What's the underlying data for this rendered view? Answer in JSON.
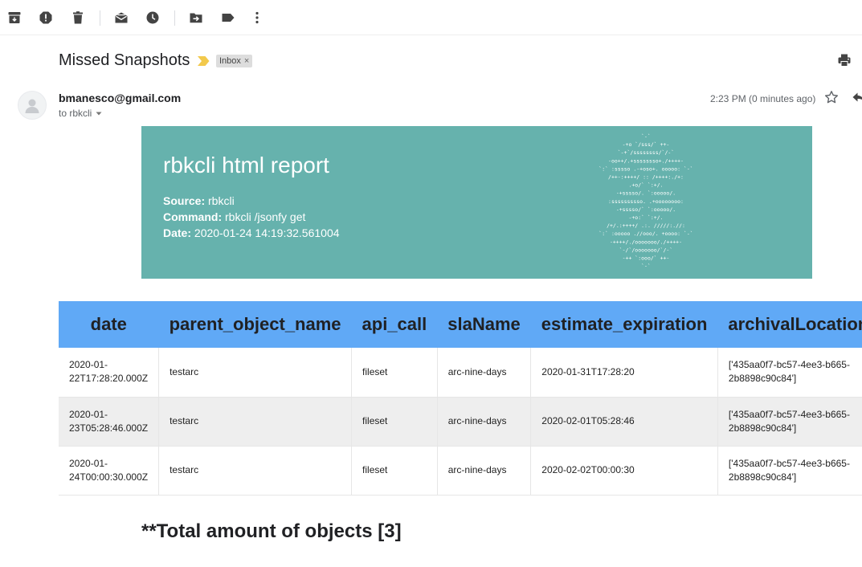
{
  "toolbar": {
    "icons": [
      "archive-icon",
      "report-spam-icon",
      "delete-icon",
      "mark-unread-icon",
      "snooze-icon",
      "move-to-icon",
      "label-icon",
      "more-icon"
    ]
  },
  "email": {
    "subject": "Missed Snapshots",
    "label": "Inbox",
    "label_close": "×",
    "sender": "bmanesco@gmail.com",
    "recipient": "to rbkcli",
    "time": "2:23 PM (0 minutes ago)"
  },
  "banner": {
    "title": "rbkcli html report",
    "source_label": "Source:",
    "source_value": "rbkcli",
    "command_label": "Command:",
    "command_value": "rbkcli /jsonfy get",
    "date_label": "Date:",
    "date_value": "2020-01-24 14:19:32.561004",
    "background": "#66b2ad",
    "ascii_art": [
      "`-`",
      "-+o    `/sss/`    ++-",
      "`-+`/ssssssss/`/-`",
      "-oo++/.+ssssssso+./++++-",
      "`:` :sssso  .-+oso+.   ooooo: `-`",
      "/++-:++++/       ::        /++++:./+:",
      ".+o/`                         `:+/.",
      "-+sssso/.                   `:ooooo/.",
      ":ssssssssso.                .+oooooooo:",
      "-+sssso/`                   `:ooooo/.",
      "-+o:`                         `:+/.",
      "/+/.:++++/        .:.        /////:.//:",
      "`:` :ooooo   .//ooo/.   +oooo:  `-`",
      "-++++/./ooooooo/./++++-",
      "`-/`/ooooooo/`/-`",
      "-++    `:ooo/`    ++-",
      "`-`"
    ]
  },
  "table": {
    "headers": [
      "date",
      "parent_object_name",
      "api_call",
      "slaName",
      "estimate_expiration",
      "archivalLocation"
    ],
    "rows": [
      [
        "2020-01-22T17:28:20.000Z",
        "testarc",
        "fileset",
        "arc-nine-days",
        "2020-01-31T17:28:20",
        "['435aa0f7-bc57-4ee3-b665-2b8898c90c84']"
      ],
      [
        "2020-01-23T05:28:46.000Z",
        "testarc",
        "fileset",
        "arc-nine-days",
        "2020-02-01T05:28:46",
        "['435aa0f7-bc57-4ee3-b665-2b8898c90c84']"
      ],
      [
        "2020-01-24T00:00:30.000Z",
        "testarc",
        "fileset",
        "arc-nine-days",
        "2020-02-02T00:00:30",
        "['435aa0f7-bc57-4ee3-b665-2b8898c90c84']"
      ]
    ],
    "header_color": "#60a9f6"
  },
  "footer": {
    "total": "**Total amount of objects [3]"
  },
  "colors": {
    "important_marker": "#f2c94c"
  }
}
